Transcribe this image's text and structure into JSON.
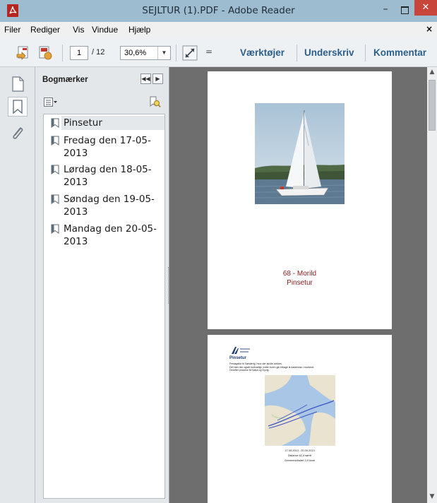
{
  "window": {
    "title": "SEJLTUR (1).PDF - Adobe Reader",
    "minimize_glyph": "–",
    "close_glyph": "✕"
  },
  "menu": {
    "items": [
      {
        "label": "Filer"
      },
      {
        "label": "Rediger"
      },
      {
        "label": "Vis"
      },
      {
        "label": "Vindue"
      },
      {
        "label": "Hjælp"
      }
    ],
    "close_glyph": "×"
  },
  "toolbar": {
    "current_page": "1",
    "page_total": "/ 12",
    "zoom": "30,6%",
    "zoom_arrow": "▼",
    "more_glyph": "=",
    "links": [
      {
        "label": "Værktøjer"
      },
      {
        "label": "Underskriv"
      },
      {
        "label": "Kommentar"
      }
    ]
  },
  "bookmarks": {
    "title": "Bogmærker",
    "nav_prev": "◀◀",
    "nav_next": "▶",
    "items": [
      {
        "label": "Pinsetur",
        "selected": true
      },
      {
        "label": "Fredag den 17-05-2013",
        "selected": false
      },
      {
        "label": "Lørdag den 18-05-2013",
        "selected": false
      },
      {
        "label": "Søndag den 19-05-2013",
        "selected": false
      },
      {
        "label": "Mandag den 20-05-2013",
        "selected": false
      }
    ]
  },
  "document": {
    "page1": {
      "line1": "68 - Morild",
      "line2": "Pinsetur"
    },
    "page2": {
      "heading": "Pinsetur",
      "body": [
        "Fredagstur til Sønderig, hvor der skulle ankres.",
        "Det blev der ogsål kortvarligt, inden turen gik tilbage til Aabenraa i modvind.",
        "Derefter pinsetur til Kalvø og Dyvig."
      ],
      "caption": [
        "17-05-2013 - 20-05-2013",
        "Distance 62,4 sømil",
        "Gennemsnitsfart 3,9 knob"
      ]
    }
  },
  "scrollbar": {
    "up_glyph": "▲",
    "down_glyph": "▼"
  },
  "colors": {
    "titlebar": "#9ebccf",
    "close_button": "#c7453a",
    "toolbar_link": "#2b5f8a",
    "cover_text": "#8a1b1f"
  }
}
